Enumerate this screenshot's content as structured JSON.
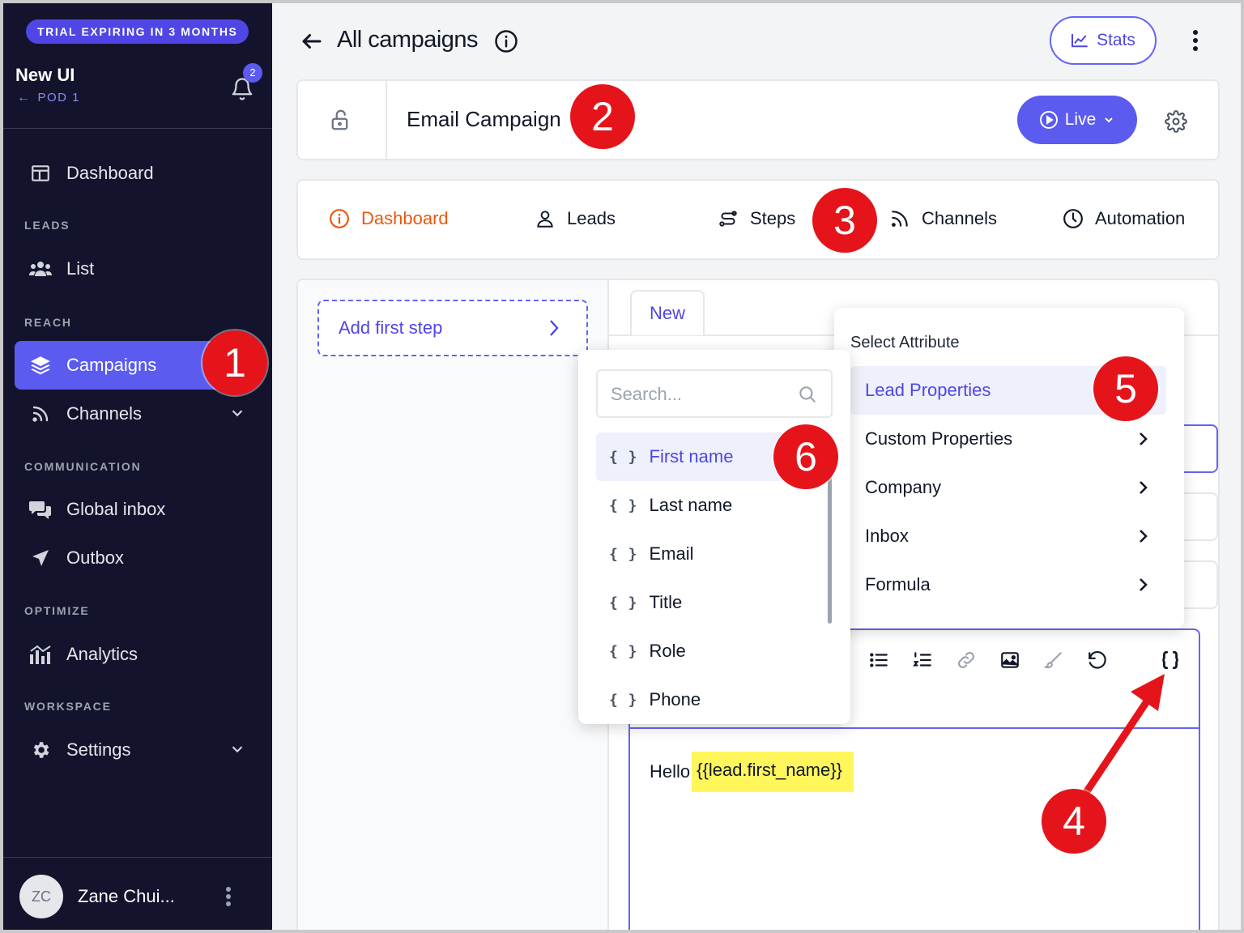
{
  "sidebar": {
    "trial_banner": "TRIAL EXPIRING IN 3 MONTHS",
    "workspace_name": "New UI",
    "workspace_sub": "POD 1",
    "notification_count": "2",
    "items": {
      "dashboard": "Dashboard",
      "list": "List",
      "campaigns": "Campaigns",
      "channels": "Channels",
      "global_inbox": "Global inbox",
      "outbox": "Outbox",
      "analytics": "Analytics",
      "settings": "Settings"
    },
    "sections": {
      "leads": "LEADS",
      "reach": "REACH",
      "communication": "COMMUNICATION",
      "optimize": "OPTIMIZE",
      "workspace": "WORKSPACE"
    },
    "user": {
      "initials": "ZC",
      "name": "Zane Chui..."
    }
  },
  "header": {
    "title": "All campaigns",
    "stats_label": "Stats"
  },
  "campaign": {
    "name": "Email Campaign",
    "status_label": "Live"
  },
  "tabs": {
    "dashboard": "Dashboard",
    "leads": "Leads",
    "steps": "Steps",
    "channels": "Channels",
    "automation": "Automation"
  },
  "steps_panel": {
    "add_step_label": "Add first step",
    "new_tab_label": "New"
  },
  "attribute_menu": {
    "title": "Select Attribute",
    "items": [
      "Lead Properties",
      "Custom Properties",
      "Company",
      "Inbox",
      "Formula"
    ]
  },
  "variable_menu": {
    "search_placeholder": "Search...",
    "brace_glyph": "{ }",
    "items": [
      "First name",
      "Last name",
      "Email",
      "Title",
      "Role",
      "Phone"
    ]
  },
  "editor": {
    "greeting": "Hello",
    "variable_token": "{{lead.first_name}}"
  },
  "annotations": [
    "1",
    "2",
    "3",
    "4",
    "5",
    "6"
  ],
  "colors": {
    "sidebar_bg": "#13132d",
    "accent": "#5b5bf0",
    "active_tab": "#ea580c",
    "annotation_red": "#e5141b",
    "highlight": "#fef65b"
  },
  "icons": {
    "sidebar": [
      "layout-icon",
      "users-icon",
      "layers-icon",
      "rss-icon",
      "chat-icon",
      "send-icon",
      "analytics-icon",
      "gear-icon"
    ],
    "toolbar": [
      "bullet-list-icon",
      "numbered-list-icon",
      "link-icon",
      "image-icon",
      "brush-icon",
      "undo-icon",
      "braces-icon"
    ]
  }
}
